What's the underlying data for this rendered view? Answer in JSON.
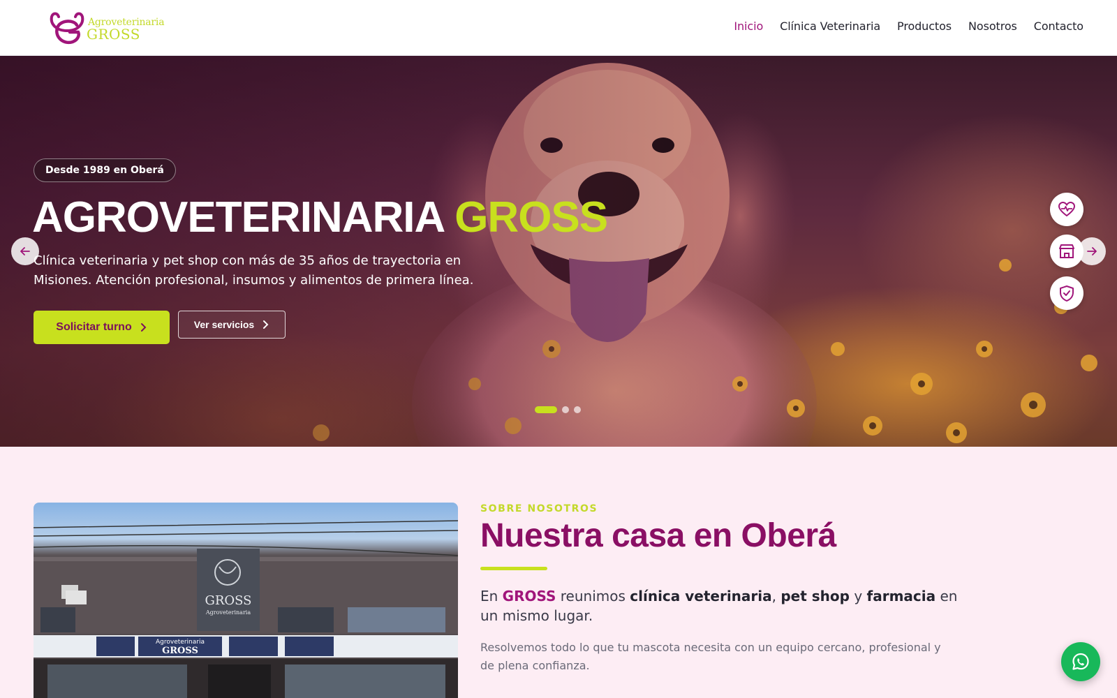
{
  "brand": {
    "logo_line1": "Agroveterinaria",
    "logo_line2": "GROSS",
    "primary_color": "#a0157a",
    "accent_color": "#c8e01e"
  },
  "nav": {
    "items": [
      {
        "label": "Inicio",
        "active": true
      },
      {
        "label": "Clínica Veterinaria",
        "active": false
      },
      {
        "label": "Productos",
        "active": false
      },
      {
        "label": "Nosotros",
        "active": false
      },
      {
        "label": "Contacto",
        "active": false
      }
    ]
  },
  "hero": {
    "badge": "Desde 1989 en Oberá",
    "title_main": "AGROVETERINARIA",
    "title_accent": "GROSS",
    "subtitle": "Clínica veterinaria y pet shop con más de 35 años de trayectoria en Misiones. Atención profesional, insumos y alimentos de primera línea.",
    "primary_button": "Solicitar turno",
    "secondary_button": "Ver servicios",
    "side_icons": [
      "heart-pulse-icon",
      "store-icon",
      "shield-check-icon"
    ],
    "slides_total": 3,
    "active_slide": 1
  },
  "about": {
    "eyebrow": "SOBRE NOSOTROS",
    "title": "Nuestra casa en Oberá",
    "lead_parts": {
      "p1": "En ",
      "brand": "GROSS",
      "p2": " reunimos ",
      "b1": "clínica veterinaria",
      "p3": ", ",
      "b2": "pet shop",
      "p4": " y ",
      "b3": "farmacia",
      "p5": " en un mismo lugar."
    },
    "body": "Resolvemos todo lo que tu mascota necesita con un equipo cercano, profesional y de plena confianza.",
    "photo_sign_name": "GROSS",
    "photo_sign_sub": "Agroveterinaria",
    "photo_banner_name": "GROSS",
    "photo_banner_sub": "Agroveterinaria"
  },
  "floating": {
    "whatsapp_icon": "whatsapp-icon",
    "whatsapp_color": "#18b85a"
  }
}
